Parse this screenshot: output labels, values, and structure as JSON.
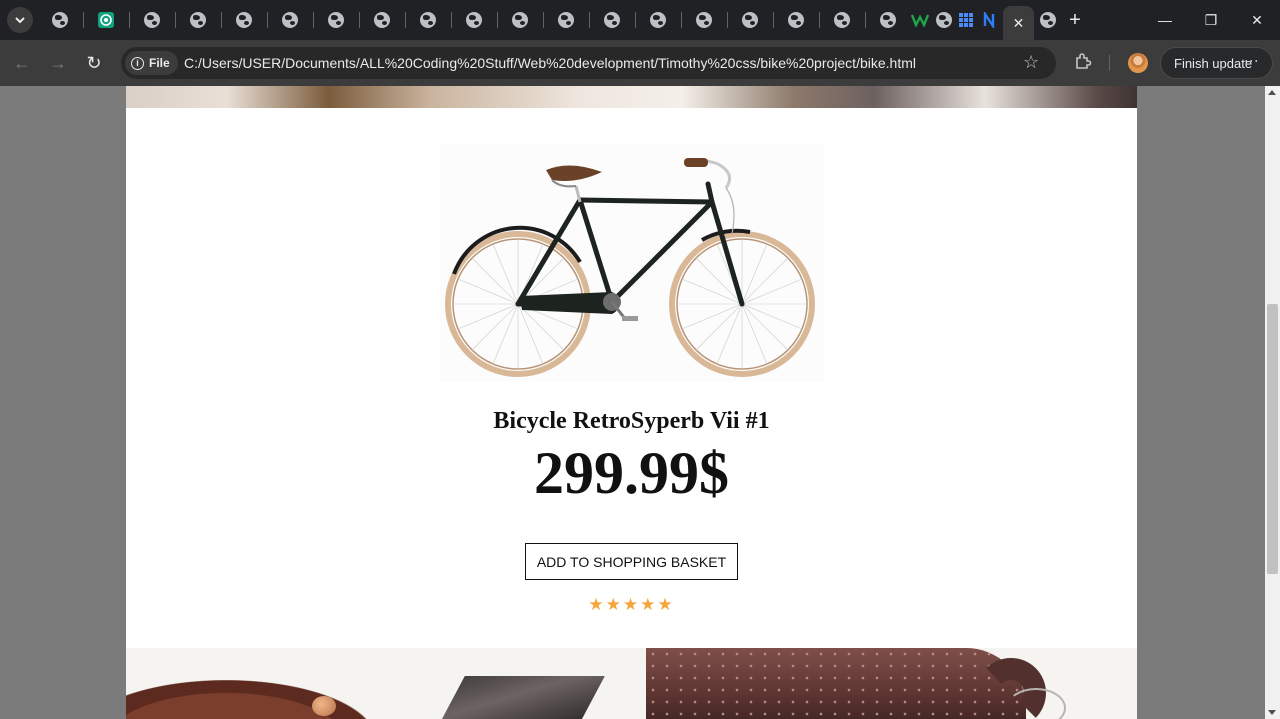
{
  "browser": {
    "active_tab_close": "✕",
    "new_tab": "+",
    "tab_favicons": [
      "globe-icon",
      "chatgpt-icon",
      "globe-icon",
      "globe-icon",
      "globe-icon",
      "globe-icon",
      "globe-icon",
      "globe-icon",
      "globe-icon",
      "globe-icon",
      "globe-icon",
      "globe-icon",
      "globe-icon",
      "globe-icon",
      "globe-icon",
      "globe-icon",
      "globe-icon",
      "globe-icon",
      "w-icon",
      "globe-icon",
      "grid-icon",
      "n-icon",
      "globe-icon"
    ],
    "window_controls": {
      "minimize": "—",
      "restore": "❐",
      "close": "✕"
    },
    "nav": {
      "back": "←",
      "forward": "→",
      "reload": "↻"
    },
    "site_chip": "File",
    "url": "C:/Users/USER/Documents/ALL%20Coding%20Stuff/Web%20development/Timothy%20css/bike%20project/bike.html",
    "bookmark": "☆",
    "update_label": "Finish update",
    "menu_dots": "⋮"
  },
  "product": {
    "name": "Bicycle RetroSyperb Vii #1",
    "price": "299.99$",
    "button_label": "ADD TO SHOPPING BASKET",
    "rating": 5,
    "stars": "★★★★★",
    "star_color": "#f4a63a"
  }
}
